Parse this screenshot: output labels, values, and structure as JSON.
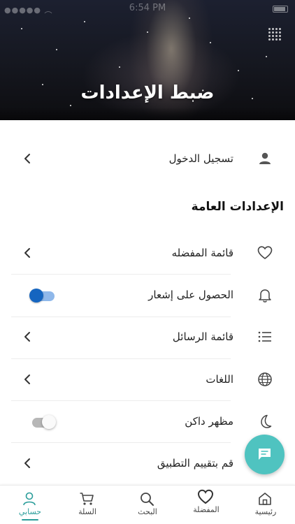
{
  "status_bar": {
    "time": "6:54 PM"
  },
  "header": {
    "title": "ضبط الإعدادات"
  },
  "account": {
    "login_label": "تسجيل الدخول"
  },
  "general": {
    "section_title": "الإعدادات العامة",
    "items": [
      {
        "label": "قائمة المفضله",
        "icon": "heart-icon",
        "control": "chevron"
      },
      {
        "label": "الحصول على إشعار",
        "icon": "bell-icon",
        "control": "toggle",
        "toggle_on": true
      },
      {
        "label": "قائمة الرسائل",
        "icon": "list-icon",
        "control": "chevron"
      },
      {
        "label": "اللغات",
        "icon": "globe-icon",
        "control": "chevron"
      },
      {
        "label": "مظهر داكن",
        "icon": "moon-icon",
        "control": "toggle",
        "toggle_on": false
      },
      {
        "label": "قم بتقييم التطبيق",
        "icon": "star-icon",
        "control": "chevron"
      }
    ]
  },
  "fab": {
    "icon": "chat-icon"
  },
  "bottom_nav": {
    "items": [
      {
        "label": "حسابي",
        "icon": "user-icon",
        "active": true
      },
      {
        "label": "السلة",
        "icon": "cart-icon",
        "active": false
      },
      {
        "label": "البحث",
        "icon": "search-icon",
        "active": false
      },
      {
        "label": "المفضلة",
        "icon": "heart-icon",
        "active": false
      },
      {
        "label": "رئيسية",
        "icon": "home-icon",
        "active": false
      }
    ]
  },
  "colors": {
    "accent": "#2a9d9a",
    "fab": "#4fc3c0",
    "toggle_on_knob": "#1565c0",
    "toggle_on_track": "#8fb8ea"
  }
}
